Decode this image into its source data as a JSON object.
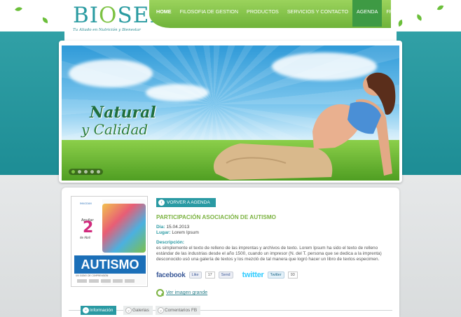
{
  "brand": {
    "name_part1": "BI",
    "name_part2": "O",
    "name_part3": "SER",
    "tagline": "Tu Aliado en Nutrición y Bienestar"
  },
  "nav": {
    "items": [
      {
        "label": "HOME"
      },
      {
        "label": "FILOSOFIA DE GESTION"
      },
      {
        "label": "PRODUCTOS"
      },
      {
        "label": "SERVICIOS Y CONTACTO"
      },
      {
        "label": "AGENDA"
      },
      {
        "label": "FRANQUICIA"
      }
    ],
    "active": "HOME",
    "current": "AGENDA",
    "color": "#7cc242"
  },
  "banner": {
    "slogan_line1": "Natural",
    "slogan_line2": "y Calidad",
    "slides": 5,
    "active_slide": 1
  },
  "poster": {
    "brand": "IMAGDAN",
    "date_line": "Aguilar",
    "number": "2",
    "date_line2": "de Abril",
    "title": "AUTISMO",
    "subtitle": "UN SIGNO DE COMPRENSIÓN"
  },
  "event": {
    "back_label": "VORVER A AGENDA",
    "title": "PARTICIPACIÓN ASOCIACIÓN DE AUTISMO",
    "dia_label": "Dia:",
    "dia_value": "15.04.2013",
    "lugar_label": "Lugar:",
    "lugar_value": "Lorem Ipsum",
    "desc_label": "Descripción:",
    "description": "es simplemente el texto de relleno de las imprentas y archivos de texto. Lorem Ipsum ha sido el texto de relleno estándar de las industrias desde el año 1500, cuando un impresor (N. del T. persona que se dedica a la imprenta) desconocido usó una galería de textos y los mezcló de tal manera que logró hacer un libro de textos especimen."
  },
  "social": {
    "facebook": "facebook",
    "like_label": "Like",
    "like_count": "17",
    "send_label": "Send",
    "twitter": "twitter",
    "tweet_label": "Twitter",
    "tweet_count": "93"
  },
  "zoom": {
    "label": "Ver imagen grande"
  },
  "tabs": [
    {
      "label": "Información"
    },
    {
      "label": "Galerias"
    },
    {
      "label": "Comentarios FB"
    }
  ],
  "colors": {
    "teal": "#2a9aa3",
    "green": "#7cc242"
  }
}
